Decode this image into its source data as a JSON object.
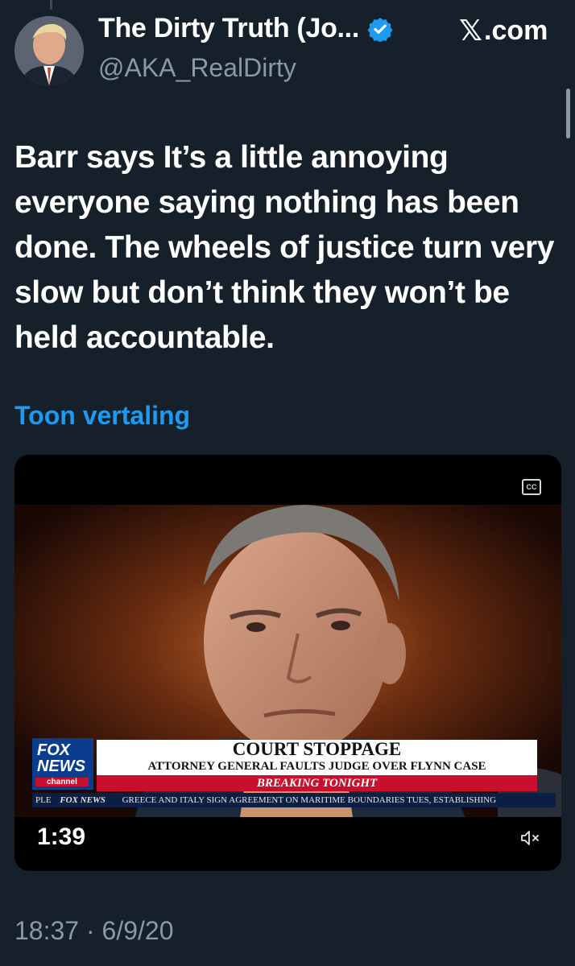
{
  "author": {
    "display_name": "The Dirty Truth (Jo...",
    "handle": "@AKA_RealDirty",
    "avatar_icon": "profile-photo",
    "verified_icon": "verified-badge-icon"
  },
  "site": {
    "brand_glyph": "𝕏",
    "label": ".com"
  },
  "tweet": {
    "text": "Barr says It’s a little annoying everyone saying nothing has been done. The wheels of justice turn very slow but don’t think they won’t be held accountable.",
    "translate_label": "Toon vertaling",
    "timestamp": "18:37 · 6/9/20"
  },
  "video": {
    "duration": "1:39",
    "cc_label": "CC",
    "mute_icon": "speaker-muted-icon",
    "chyron": {
      "logo_line1": "FOX",
      "logo_line2": "NEWS",
      "logo_line3": "channel",
      "headline": "COURT STOPPAGE",
      "subheadline": "ATTORNEY GENERAL FAULTS JUDGE OVER FLYNN CASE",
      "breaking": "BREAKING TONIGHT",
      "ticker_left": "PLE",
      "ticker_brand": "FOX NEWS",
      "ticker_text": "GREECE AND ITALY SIGN AGREEMENT ON MARITIME BOUNDARIES TUES, ESTABLISHING"
    }
  },
  "colors": {
    "background": "#15202b",
    "link": "#1d9bf0",
    "muted_text": "#8b98a5",
    "fox_blue": "#0b3d8f",
    "fox_red": "#c8102e"
  }
}
